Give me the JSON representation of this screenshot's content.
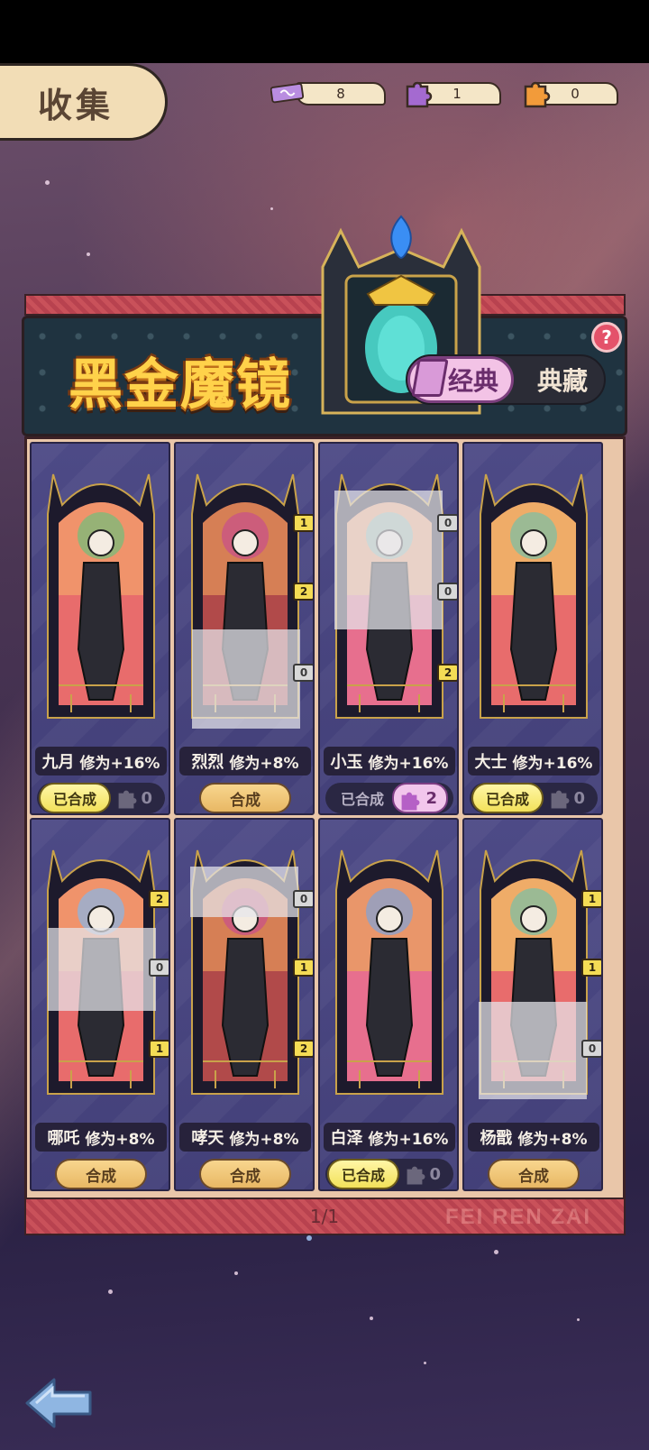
{
  "header": {
    "title": "收集"
  },
  "resources": [
    {
      "name": "ticket",
      "icon": "ticket-icon",
      "value": "8"
    },
    {
      "name": "purple-piece",
      "icon": "purple-puzzle-icon",
      "value": "1"
    },
    {
      "name": "orange-piece",
      "icon": "orange-puzzle-icon",
      "value": "0"
    }
  ],
  "banner": {
    "title": "黑金魔镜",
    "tabs": {
      "active": "经典",
      "inactive": "典藏"
    },
    "help": "?"
  },
  "cards": [
    {
      "name": "九月",
      "bonus": "修为+16%",
      "status": "已合成",
      "pieces": "0",
      "badges": []
    },
    {
      "name": "烈烈",
      "bonus": "修为+8%",
      "status": "合成",
      "badges": [
        "1",
        "2",
        "0"
      ]
    },
    {
      "name": "小玉",
      "bonus": "修为+16%",
      "status": "已合成",
      "pieces": "2",
      "badges": [
        "0",
        "0",
        "2"
      ]
    },
    {
      "name": "大士",
      "bonus": "修为+16%",
      "status": "已合成",
      "pieces": "0",
      "badges": []
    },
    {
      "name": "哪吒",
      "bonus": "修为+8%",
      "status": "合成",
      "badges": [
        "2",
        "0",
        "1"
      ]
    },
    {
      "name": "哮天",
      "bonus": "修为+8%",
      "status": "合成",
      "badges": [
        "0",
        "1",
        "2"
      ]
    },
    {
      "name": "白泽",
      "bonus": "修为+16%",
      "status": "已合成",
      "pieces": "0",
      "badges": []
    },
    {
      "name": "杨戬",
      "bonus": "修为+8%",
      "status": "合成",
      "badges": [
        "1",
        "1",
        "0"
      ]
    }
  ],
  "pagination": {
    "label": "1/1"
  },
  "watermark": "FEI REN ZAI",
  "colors": {
    "accent_gold": "#ffd24a",
    "banner_bg": "#1f3340",
    "card_bg": "#4d4a86",
    "badge_yellow": "#f4dc55",
    "piece_pink": "#f2c6ec"
  }
}
